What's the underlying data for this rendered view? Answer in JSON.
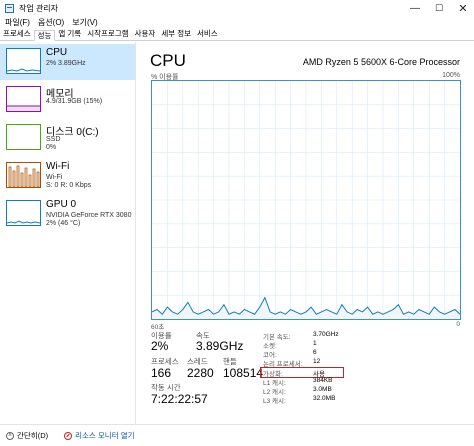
{
  "window": {
    "title": "작업 관리자"
  },
  "menu": [
    "파일(F)",
    "옵션(O)",
    "보기(V)"
  ],
  "tabs": [
    "프로세스",
    "성능",
    "앱 기록",
    "시작프로그램",
    "사용자",
    "세부 정보",
    "서비스"
  ],
  "active_tab": 1,
  "sidebar": [
    {
      "name": "CPU",
      "sub1": "2% 3.89GHz",
      "sub2": "",
      "color": "#117dbb"
    },
    {
      "name": "메모리",
      "sub1": "4.9/31.9GB (15%)",
      "sub2": "",
      "color": "#8b12ae"
    },
    {
      "name": "디스크 0(C:)",
      "sub1": "SSD",
      "sub2": "0%",
      "color": "#4da60c"
    },
    {
      "name": "Wi-Fi",
      "sub1": "Wi-Fi",
      "sub2": "S: 0 R: 0 Kbps",
      "color": "#a74f01"
    },
    {
      "name": "GPU 0",
      "sub1": "NVIDIA GeForce RTX 3080",
      "sub2": "2% (46 °C)",
      "color": "#117dbb"
    }
  ],
  "main": {
    "title": "CPU",
    "processor": "AMD Ryzen 5 5600X 6-Core Processor",
    "util_label": "% 이용률",
    "util_max": "100%",
    "x_left": "60초",
    "x_right": "0",
    "utilization_label": "이용률",
    "utilization": "2%",
    "speed_label": "속도",
    "speed": "3.89GHz",
    "processes_label": "프로세스",
    "processes": "166",
    "threads_label": "스레드",
    "threads": "2280",
    "handles_label": "핸들",
    "handles": "108514",
    "uptime_label": "작동 시간",
    "uptime": "7:22:22:57"
  },
  "specs": [
    {
      "label": "기본 속도:",
      "value": "3.70GHz"
    },
    {
      "label": "소켓:",
      "value": "1"
    },
    {
      "label": "코어:",
      "value": "6"
    },
    {
      "label": "논리 프로세서:",
      "value": "12"
    },
    {
      "label": "가상화:",
      "value": "사용"
    },
    {
      "label": "L1 캐시:",
      "value": "384KB"
    },
    {
      "label": "L2 캐시:",
      "value": "3.0MB"
    },
    {
      "label": "L3 캐시:",
      "value": "32.0MB"
    }
  ],
  "footer": {
    "fewer": "간단히(D)",
    "monitor": "리소스 모니터 열기"
  },
  "colors": {
    "accent": "#117dbb",
    "selected": "#cce8ff",
    "highlight": "#d11f1f"
  },
  "chart_data": {
    "type": "area",
    "title": "",
    "xlabel": "",
    "ylabel": "% 이용률",
    "ylim": [
      0,
      100
    ],
    "xlim": [
      60,
      0
    ],
    "grid": true,
    "series": [
      {
        "values": [
          3,
          4,
          2,
          5,
          3,
          2,
          4,
          7,
          3,
          2,
          3,
          4,
          2,
          3,
          6,
          2,
          3,
          2,
          4,
          3,
          2,
          5,
          9,
          3,
          2,
          3,
          2,
          4,
          3,
          2,
          3,
          5,
          2,
          3,
          4,
          3,
          2,
          6,
          3,
          2,
          4,
          3,
          5,
          2,
          3,
          2,
          3,
          4,
          6,
          2,
          3,
          2,
          4,
          3,
          2,
          5,
          3,
          2,
          3,
          4,
          2
        ]
      }
    ]
  }
}
